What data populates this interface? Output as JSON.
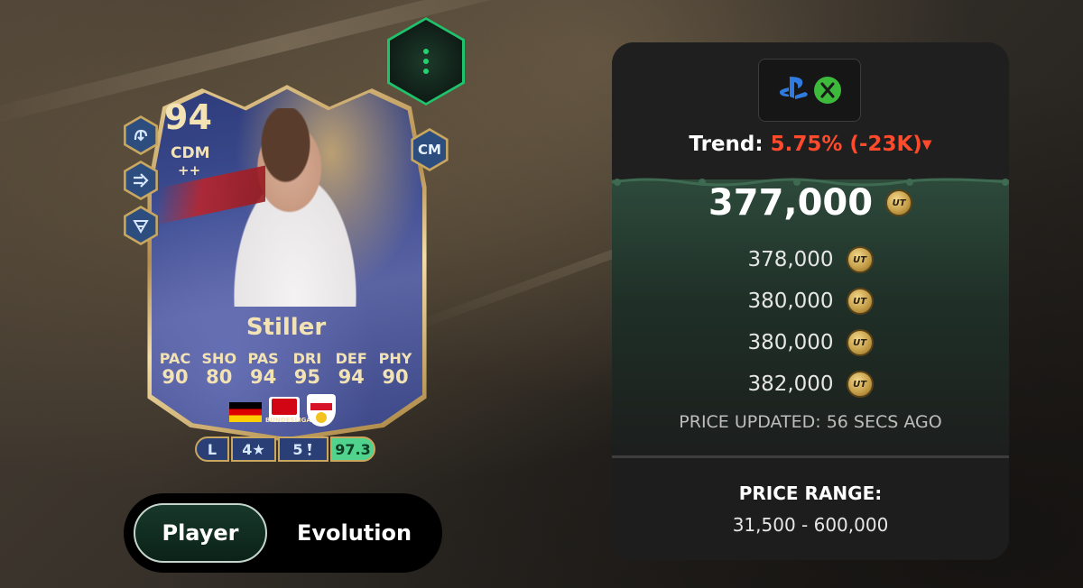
{
  "card": {
    "rating": "94",
    "position": "CDM",
    "position_plus": "++",
    "alt_position": "CM",
    "name": "Stiller",
    "stats": [
      {
        "label": "PAC",
        "value": "90"
      },
      {
        "label": "SHO",
        "value": "80"
      },
      {
        "label": "PAS",
        "value": "94"
      },
      {
        "label": "DRI",
        "value": "95"
      },
      {
        "label": "DEF",
        "value": "94"
      },
      {
        "label": "PHY",
        "value": "90"
      }
    ],
    "league_text": "BUNDESLIGA",
    "pills": {
      "foot": "L",
      "weak_foot": "4★",
      "skill_moves": "5",
      "rating": "97.3"
    },
    "playstyle_icons": [
      "anticipate-icon",
      "incisive-pass-icon",
      "intercept-icon"
    ]
  },
  "toggle": {
    "player_label": "Player",
    "evolution_label": "Evolution"
  },
  "panel": {
    "platform_icons": [
      "playstation-icon",
      "xbox-icon"
    ],
    "trend_label": "Trend:",
    "trend_value": "5.75% (-23K)",
    "trend_arrow": "▼",
    "price_main": "377,000",
    "coin_text": "UT",
    "prices": [
      "378,000",
      "380,000",
      "380,000",
      "382,000"
    ],
    "updated": "PRICE UPDATED: 56 SECS AGO",
    "range_title": "PRICE RANGE:",
    "range_value": "31,500 - 600,000"
  },
  "colors": {
    "trend_negative": "#ff4a2b",
    "accent_green": "#1fc36b",
    "card_gold": "#f3e3b4"
  }
}
